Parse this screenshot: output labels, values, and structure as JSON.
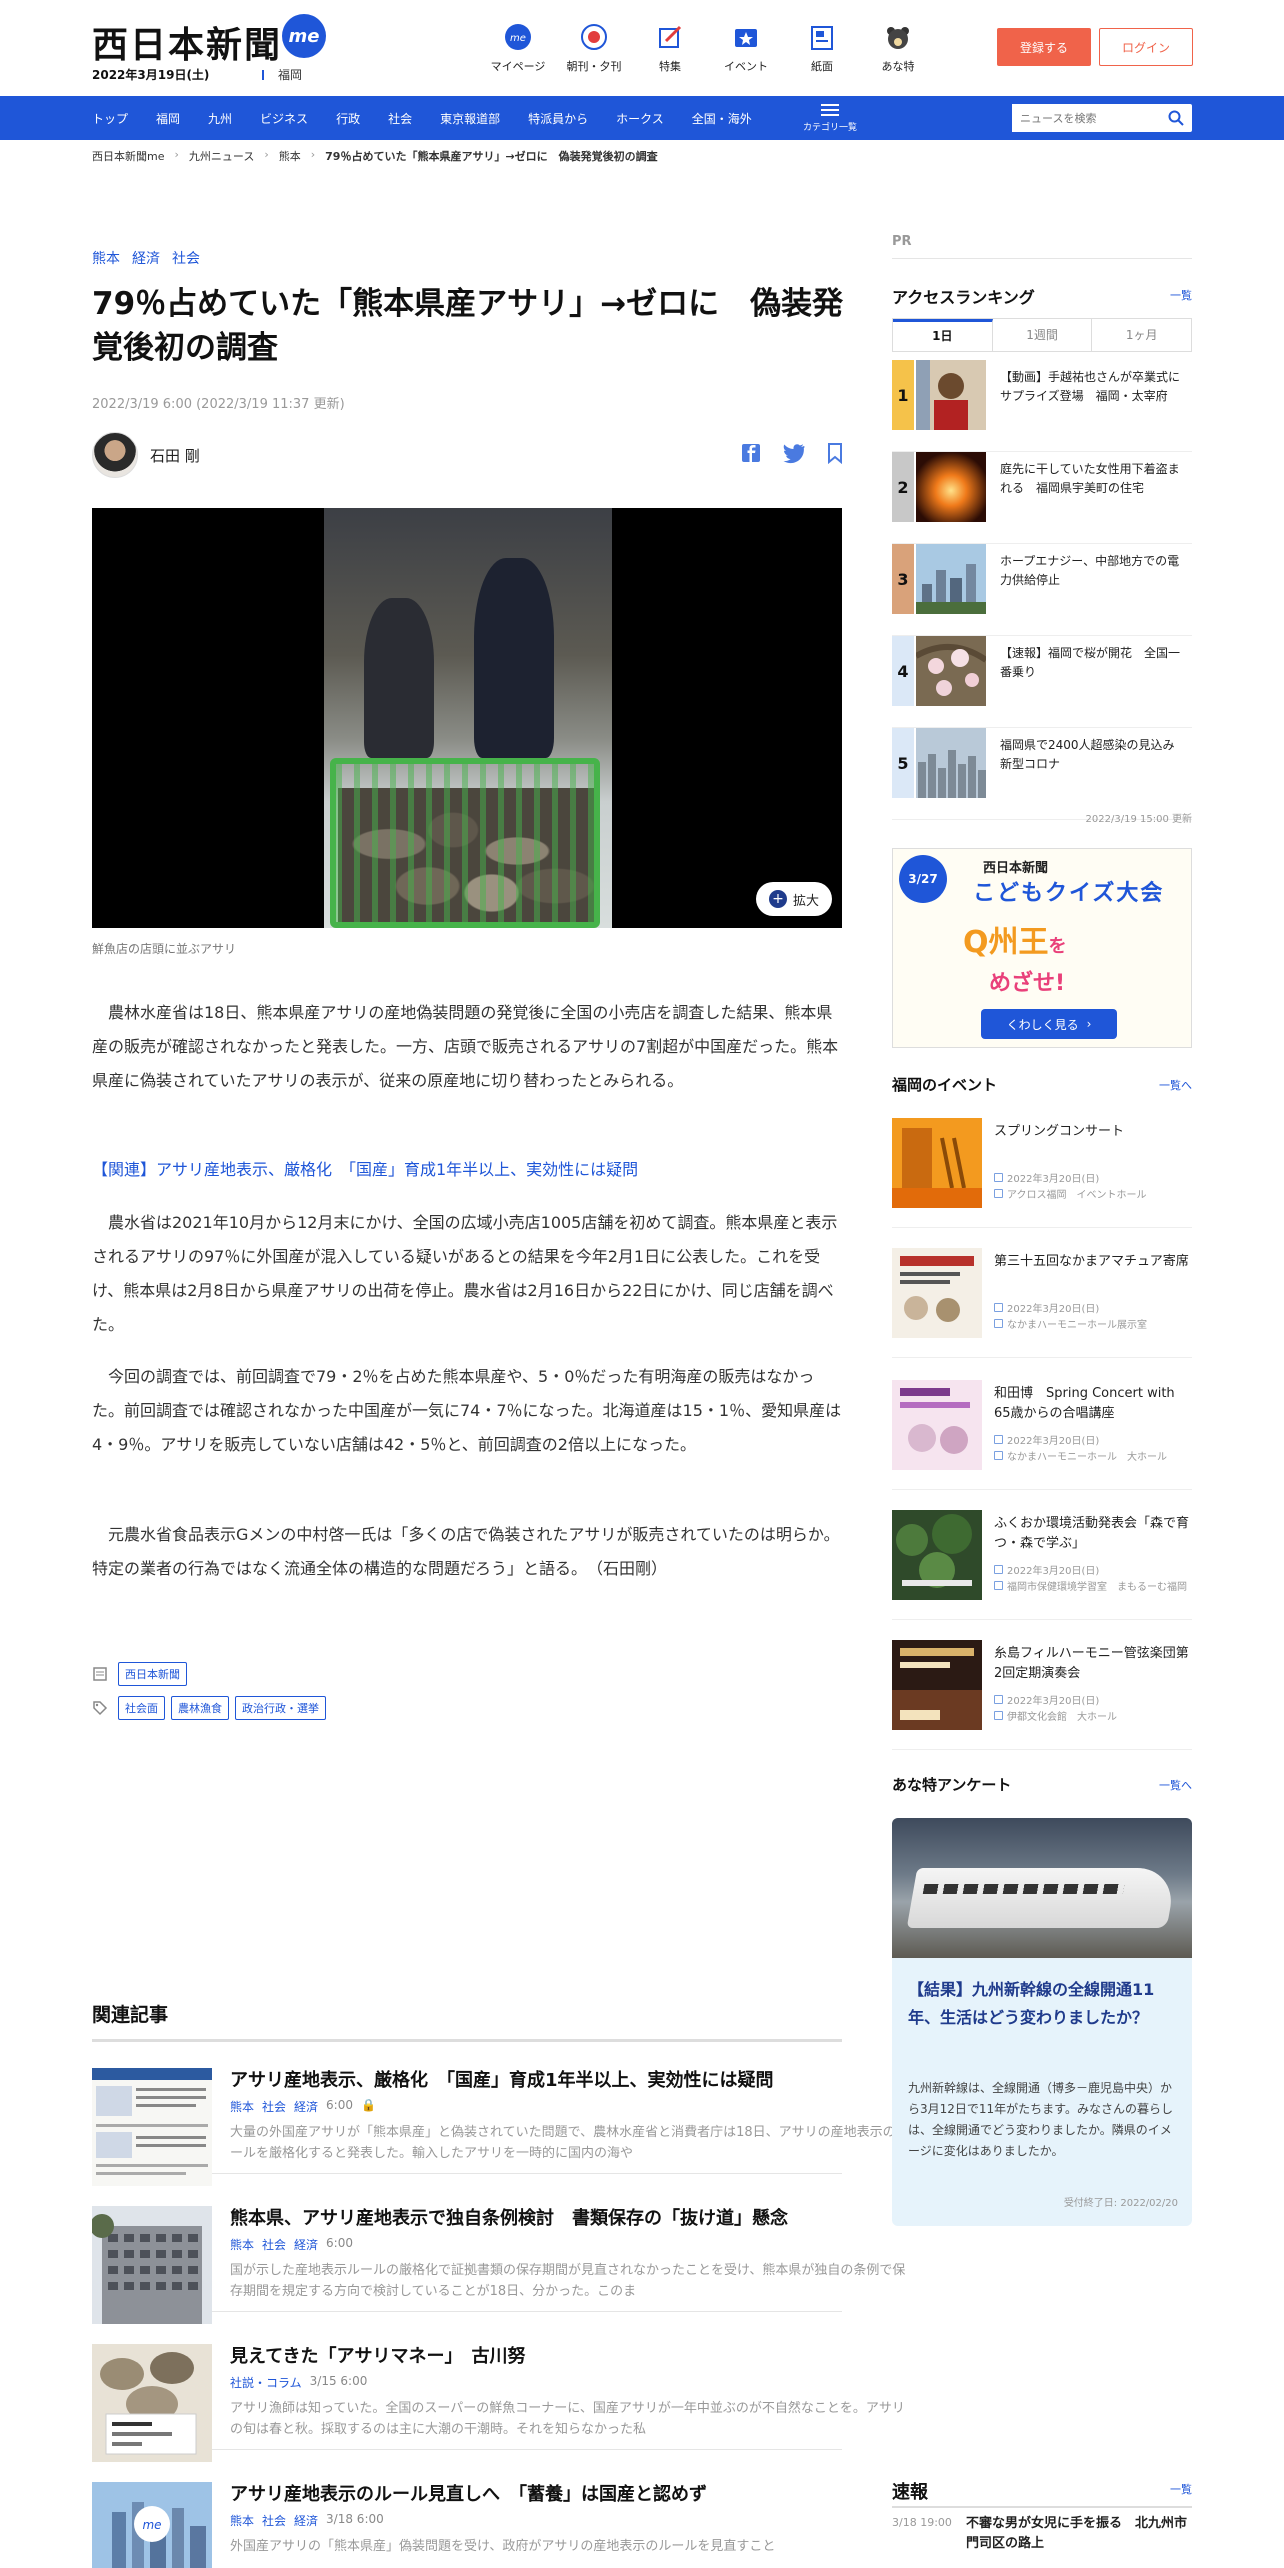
{
  "header": {
    "logo": "西日本新聞",
    "logo_badge": "me",
    "date": "2022年3月19日(土)",
    "region": "福岡",
    "nav_icons": [
      {
        "label": "マイページ",
        "icon": "me-icon"
      },
      {
        "label": "朝刊・夕刊",
        "icon": "newspaper-icon"
      },
      {
        "label": "特集",
        "icon": "feature-icon"
      },
      {
        "label": "イベント",
        "icon": "event-icon"
      },
      {
        "label": "紙面",
        "icon": "paper-icon"
      },
      {
        "label": "あな特",
        "icon": "bear-icon"
      }
    ],
    "register": "登録する",
    "login": "ログイン"
  },
  "categories": [
    "トップ",
    "福岡",
    "九州",
    "ビジネス",
    "行政",
    "社会",
    "東京報道部",
    "特派員から",
    "ホークス",
    "全国・海外"
  ],
  "category_list": "カテゴリ一覧",
  "search_placeholder": "ニュースを検索",
  "breadcrumb": [
    "西日本新聞me",
    "九州ニュース",
    "熊本",
    "79％占めていた「熊本県産アサリ」→ゼロに　偽装発覚後初の調査"
  ],
  "article": {
    "tags": [
      "熊本",
      "経済",
      "社会"
    ],
    "title": "79％占めていた「熊本県産アサリ」→ゼロに　偽装発覚後初の調査",
    "date": "2022/3/19 6:00 (2022/3/19 11:37 更新)",
    "author": "石田 剛",
    "zoom": "拡大",
    "caption": "鮮魚店の店頭に並ぶアサリ",
    "paragraphs": [
      "農林水産省は18日、熊本県産アサリの産地偽装問題の発覚後に全国の小売店を調査した結果、熊本県産の販売が確認されなかったと発表した。一方、店頭で販売されるアサリの7割超が中国産だった。熊本県産に偽装されていたアサリの表示が、従来の原産地に切り替わったとみられる。",
      "農水省は2021年10月から12月末にかけ、全国の広域小売店1005店舗を初めて調査。熊本県産と表示されるアサリの97％に外国産が混入している疑いがあるとの結果を今年2月1日に公表した。これを受け、熊本県は2月8日から県産アサリの出荷を停止。農水省は2月16日から22日にかけ、同じ店舗を調べた。",
      "今回の調査では、前回調査で79・2％を占めた熊本県産や、5・0％だった有明海産の販売はなかった。前回調査では確認されなかった中国産が一気に74・7％になった。北海道産は15・1％、愛知県産は4・9％。アサリを販売していない店舗は42・5％と、前回調査の2倍以上になった。",
      "元農水省食品表示Gメンの中村啓一氏は「多くの店で偽装されたアサリが販売されていたのは明らか。特定の業者の行為ではなく流通全体の構造的な問題だろう」と語る。　（石田剛）"
    ],
    "related_link": "【関連】アサリ産地表示、厳格化　「国産」育成1年半以上、実効性には疑問",
    "source_tag": "西日本新聞",
    "topic_tags": [
      "社会面",
      "農林漁食",
      "政治行政・選挙"
    ]
  },
  "related": {
    "heading": "関連記事",
    "items": [
      {
        "title": "アサリ産地表示、厳格化　「国産」育成1年半以上、実効性には疑問",
        "tags": [
          "熊本",
          "社会",
          "経済"
        ],
        "time": "6:00",
        "excerpt": "大量の外国産アサリが「熊本県産」と偽装されていた問題で、農林水産省と消費者庁は18日、アサリの産地表示のルールを厳格化すると発表した。輸入したアサリを一時的に国内の海や"
      },
      {
        "title": "熊本県、アサリ産地表示で独自条例検討　書類保存の「抜け道」懸念",
        "tags": [
          "熊本",
          "社会",
          "経済"
        ],
        "time": "6:00",
        "excerpt": "国が示した産地表示ルールの厳格化で証拠書類の保存期間が見直されなかったことを受け、熊本県が独自の条例で保存期間を規定する方向で検討していることが18日、分かった。このま"
      },
      {
        "title": "見えてきた「アサリマネー」　古川努",
        "tags": [
          "社説・コラム"
        ],
        "time": "3/15 6:00",
        "excerpt": "アサリ漁師は知っていた。全国のスーパーの鮮魚コーナーに、国産アサリが一年中並ぶのが不自然なことを。アサリの旬は春と秋。採取するのは主に大潮の干潮時。それを知らなかった私"
      },
      {
        "title": "アサリ産地表示のルール見直しへ　「蓄養」は国産と認めず",
        "tags": [
          "熊本",
          "社会",
          "経済"
        ],
        "time": "3/18 6:00",
        "excerpt": "外国産アサリの「熊本県産」偽装問題を受け、政府がアサリの産地表示のルールを見直すこと"
      }
    ]
  },
  "sidebar": {
    "pr": "PR",
    "ranking_heading": "アクセスランキング",
    "more": "一覧",
    "ranking_tabs": [
      "1日",
      "1週間",
      "1ヶ月"
    ],
    "ranking": [
      {
        "rank": "1",
        "title": "【動画】手越祐也さんが卒業式にサプライズ登場　福岡・太宰府",
        "color": "#f5c24a"
      },
      {
        "rank": "2",
        "title": "庭先に干していた女性用下着盗まれる　福岡県宇美町の住宅",
        "color": "#c8c8c8"
      },
      {
        "rank": "3",
        "title": "ホープエナジー、中部地方での電力供給停止",
        "color": "#d9a27a"
      },
      {
        "rank": "4",
        "title": "【速報】福岡で桜が開花　全国一番乗り",
        "color": "#dbe8f7"
      },
      {
        "rank": "5",
        "title": "福岡県で2400人超感染の見込み　新型コロナ",
        "color": "#dbe8f7"
      }
    ],
    "ranking_updated": "2022/3/19 15:00 更新",
    "quiz": {
      "date_top": "3/",
      "date_bottom": "27",
      "brand": "西日本新聞",
      "title": "こどもクイズ大会",
      "main": "Q州王",
      "sub_line1": "を",
      "sub_line2": "めざせ!",
      "button": "くわしく見る"
    },
    "events_heading": "福岡のイベント",
    "events_more": "一覧へ",
    "events": [
      {
        "title": "スプリングコンサート",
        "date": "2022年3月20日(日)",
        "place": "アクロス福岡　イベントホール"
      },
      {
        "title": "第三十五回なかまアマチュア寄席",
        "date": "2022年3月20日(日)",
        "place": "なかまハーモニーホール展示室"
      },
      {
        "title": "和田博　Spring Concert with 65歳からの合唱講座",
        "date": "2022年3月20日(日)",
        "place": "なかまハーモニーホール　大ホール"
      },
      {
        "title": "ふくおか環境活動発表会「森で育つ・森で学ぶ」",
        "date": "2022年3月20日(日)",
        "place": "福岡市保健環境学習室　まもるーむ福岡"
      },
      {
        "title": "糸島フィルハーモニー管弦楽団第2回定期演奏会",
        "date": "2022年3月20日(日)",
        "place": "伊都文化会館　大ホール"
      }
    ],
    "survey_heading": "あな特アンケート",
    "survey_more": "一覧へ",
    "survey": {
      "question": "【結果】九州新幹線の全線開通11年、生活はどう変わりましたか？",
      "desc": "九州新幹線は、全線開通（博多－鹿児島中央）から3月12日で11年がたちます。みなさんの暮らしは、全線開通でどう変わりましたか。隣県のイメージに変化はありましたか。",
      "footer": "受付終了日: 2022/02/20"
    },
    "news_heading": "速報",
    "news_more": "一覧",
    "news": [
      {
        "time": "3/18 19:00",
        "title": "不審な男が女児に手を振る　北九州市門司区の路上"
      }
    ]
  }
}
